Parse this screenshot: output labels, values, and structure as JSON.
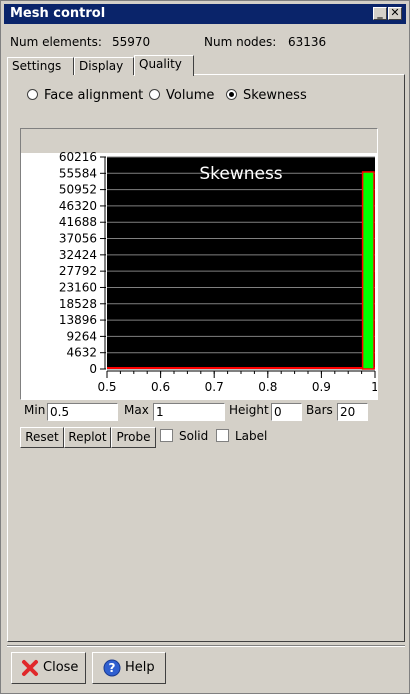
{
  "window": {
    "title": "Mesh control"
  },
  "info": {
    "elements_label": "Num elements:",
    "elements_value": "55970",
    "nodes_label": "Num nodes:",
    "nodes_value": "63136"
  },
  "tabs": [
    {
      "label": "Settings",
      "active": false
    },
    {
      "label": "Display",
      "active": false
    },
    {
      "label": "Quality",
      "active": true
    }
  ],
  "quality_mode": {
    "options": [
      "Face alignment",
      "Volume",
      "Skewness"
    ],
    "selected": "Skewness"
  },
  "chart_data": {
    "type": "bar",
    "title": "Skewness",
    "x_ticks": [
      "0.5",
      "0.6",
      "0.7",
      "0.8",
      "0.9",
      "1"
    ],
    "y_ticks": [
      "60216",
      "55584",
      "50952",
      "46320",
      "41688",
      "37056",
      "32424",
      "27792",
      "23160",
      "18528",
      "13896",
      "9264",
      "4632",
      "0"
    ],
    "xlim": [
      0.5,
      1.0
    ],
    "ylim": [
      0,
      60216
    ],
    "bins": 20,
    "bars": [
      {
        "x_start": 0.975,
        "x_end": 1.0,
        "value": 55970
      }
    ],
    "colors": {
      "background": "#000000",
      "bar_fill": "#00ff00",
      "bar_edge": "#ff0000",
      "grid": "#808080",
      "title": "#ffffff"
    }
  },
  "controls": {
    "min_label": "Min",
    "min_value": "0.5",
    "max_label": "Max",
    "max_value": "1",
    "height_label": "Height",
    "height_value": "0",
    "bars_label": "Bars",
    "bars_value": "20",
    "reset_label": "Reset",
    "replot_label": "Replot",
    "probe_label": "Probe",
    "solid_label": "Solid",
    "label_label": "Label"
  },
  "footer": {
    "close_label": "Close",
    "help_label": "Help"
  }
}
